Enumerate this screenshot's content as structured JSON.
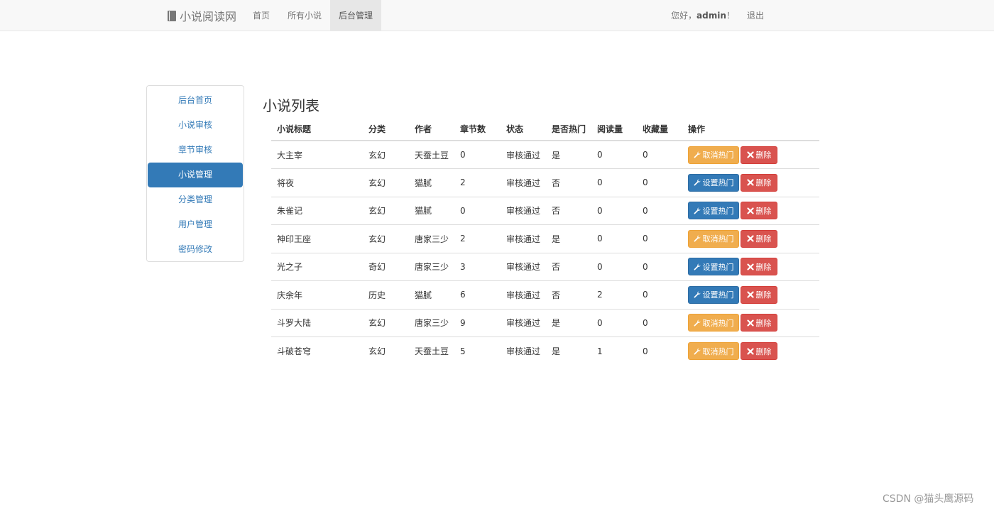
{
  "navbar": {
    "brand": "小说阅读网",
    "items": [
      {
        "label": "首页",
        "active": false
      },
      {
        "label": "所有小说",
        "active": false
      },
      {
        "label": "后台管理",
        "active": true
      }
    ],
    "greeting_prefix": "您好，",
    "username": "admin",
    "greeting_suffix": "！",
    "logout": "退出"
  },
  "sidebar": {
    "items": [
      {
        "label": "后台首页",
        "active": false
      },
      {
        "label": "小说审核",
        "active": false
      },
      {
        "label": "章节审核",
        "active": false
      },
      {
        "label": "小说管理",
        "active": true
      },
      {
        "label": "分类管理",
        "active": false
      },
      {
        "label": "用户管理",
        "active": false
      },
      {
        "label": "密码修改",
        "active": false
      }
    ]
  },
  "main": {
    "title": "小说列表",
    "columns": [
      "小说标题",
      "分类",
      "作者",
      "章节数",
      "状态",
      "是否热门",
      "阅读量",
      "收藏量",
      "操作"
    ],
    "cancel_hot_label": "取消热门",
    "set_hot_label": "设置热门",
    "delete_label": "删除",
    "rows": [
      {
        "title": "大主宰",
        "category": "玄幻",
        "author": "天蚕土豆",
        "chapters": "0",
        "status": "审核通过",
        "hot": "是",
        "reads": "0",
        "favorites": "0"
      },
      {
        "title": "将夜",
        "category": "玄幻",
        "author": "猫腻",
        "chapters": "2",
        "status": "审核通过",
        "hot": "否",
        "reads": "0",
        "favorites": "0"
      },
      {
        "title": "朱雀记",
        "category": "玄幻",
        "author": "猫腻",
        "chapters": "0",
        "status": "审核通过",
        "hot": "否",
        "reads": "0",
        "favorites": "0"
      },
      {
        "title": "神印王座",
        "category": "玄幻",
        "author": "唐家三少",
        "chapters": "2",
        "status": "审核通过",
        "hot": "是",
        "reads": "0",
        "favorites": "0"
      },
      {
        "title": "光之子",
        "category": "奇幻",
        "author": "唐家三少",
        "chapters": "3",
        "status": "审核通过",
        "hot": "否",
        "reads": "0",
        "favorites": "0"
      },
      {
        "title": "庆余年",
        "category": "历史",
        "author": "猫腻",
        "chapters": "6",
        "status": "审核通过",
        "hot": "否",
        "reads": "2",
        "favorites": "0"
      },
      {
        "title": "斗罗大陆",
        "category": "玄幻",
        "author": "唐家三少",
        "chapters": "9",
        "status": "审核通过",
        "hot": "是",
        "reads": "0",
        "favorites": "0"
      },
      {
        "title": "斗破苍穹",
        "category": "玄幻",
        "author": "天蚕土豆",
        "chapters": "5",
        "status": "审核通过",
        "hot": "是",
        "reads": "1",
        "favorites": "0"
      }
    ]
  },
  "watermark": "CSDN @猫头鹰源码",
  "colors": {
    "primary": "#337ab7",
    "warning": "#f0ad4e",
    "danger": "#d9534f"
  }
}
